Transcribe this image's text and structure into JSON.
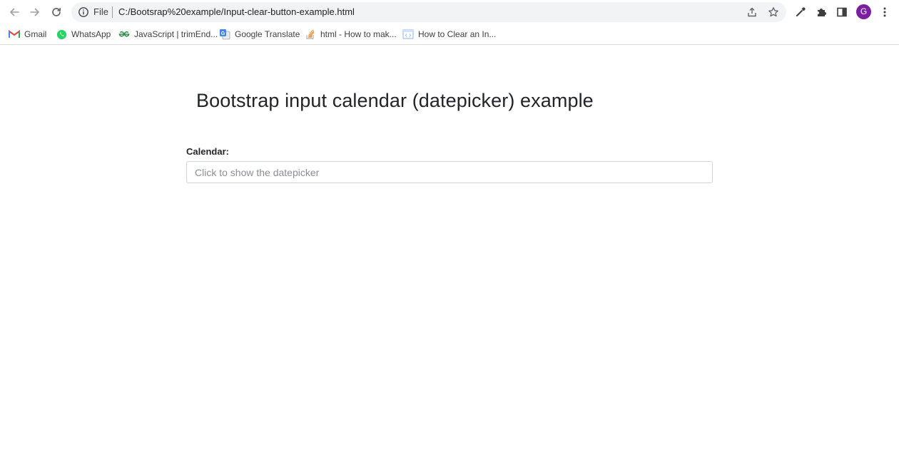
{
  "browser": {
    "omnibox": {
      "scheme_label": "File",
      "url": "C:/Bootsrap%20example/Input-clear-button-example.html"
    },
    "profile_initial": "G",
    "accent_color": "#7b1fa2"
  },
  "bookmarks": [
    {
      "label": "Gmail",
      "icon": "gmail-icon"
    },
    {
      "label": "WhatsApp",
      "icon": "whatsapp-icon"
    },
    {
      "label": "JavaScript | trimEnd...",
      "icon": "geeksforgeeks-icon"
    },
    {
      "label": "Google Translate",
      "icon": "google-translate-icon"
    },
    {
      "label": "html - How to mak...",
      "icon": "stackoverflow-icon"
    },
    {
      "label": "How to Clear an In...",
      "icon": "code-page-icon"
    }
  ],
  "page": {
    "title": "Bootstrap input calendar (datepicker) example",
    "calendar_label": "Calendar:",
    "calendar_input": {
      "value": "",
      "placeholder": "Click to show the datepicker"
    }
  }
}
